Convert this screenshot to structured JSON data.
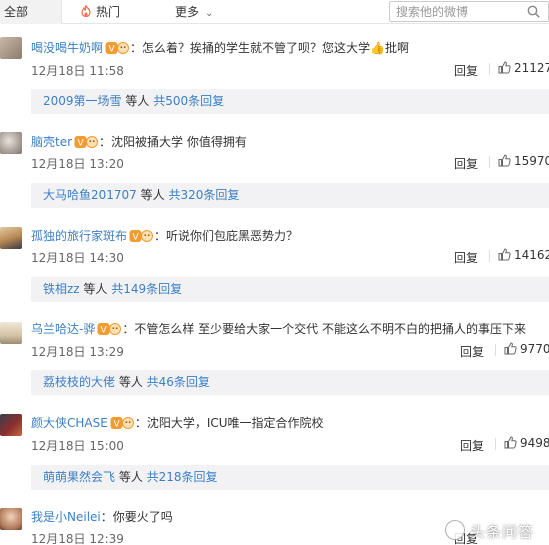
{
  "top_nav": {
    "tab_all": "全部",
    "tab_hot": "热门",
    "tab_more": "更多",
    "search_placeholder": "搜索他的微博"
  },
  "colors": {
    "link": "#3b7fc4",
    "sub_bg": "#f2f2f5",
    "vip_badge": "#f29b2e",
    "hot_icon": "#f56c4e"
  },
  "comments": [
    {
      "user": "喝没喝牛奶啊",
      "text": "：怎么着？挨捅的学生就不管了呗？您这大学👍批啊",
      "date": "12月18日 11:58",
      "reply": "回复",
      "likes": "21127",
      "sub": {
        "user": "2009第一场雪",
        "mid": " 等人 ",
        "count": "共500条回复"
      }
    },
    {
      "user": "脑壳ter",
      "text": "：沈阳被捅大学 你值得拥有",
      "date": "12月18日 13:20",
      "reply": "回复",
      "likes": "15970",
      "sub": {
        "user": "大马哈鱼201707",
        "mid": " 等人 ",
        "count": "共320条回复"
      }
    },
    {
      "user": "孤独的旅行家斑布",
      "text": "：听说你们包庇黑恶势力？",
      "date": "12月18日 14:30",
      "reply": "回复",
      "likes": "14162",
      "sub": {
        "user": "铁相zz",
        "mid": " 等人 ",
        "count": "共149条回复"
      }
    },
    {
      "user": "乌兰哈达-骅",
      "text": "：不管怎么样 至少要给大家一个交代 不能这么不明不白的把捅人的事压下来",
      "date": "12月18日 13:29",
      "reply": "回复",
      "likes": "9770",
      "sub": {
        "user": "荔枝枝的大佬",
        "mid": " 等人 ",
        "count": "共46条回复"
      }
    },
    {
      "user": "颜大侠CHASE",
      "text": "：沈阳大学，ICU唯一指定合作院校",
      "date": "12月18日 15:00",
      "reply": "回复",
      "likes": "9498",
      "sub": {
        "user": "萌萌果然会飞",
        "mid": " 等人 ",
        "count": "共218条回复"
      }
    },
    {
      "user": "我是小Neilei",
      "text": "：你要火了吗",
      "date": "12月18日 12:39",
      "reply": "回复",
      "likes": ""
    }
  ],
  "watermark": "头条问答"
}
